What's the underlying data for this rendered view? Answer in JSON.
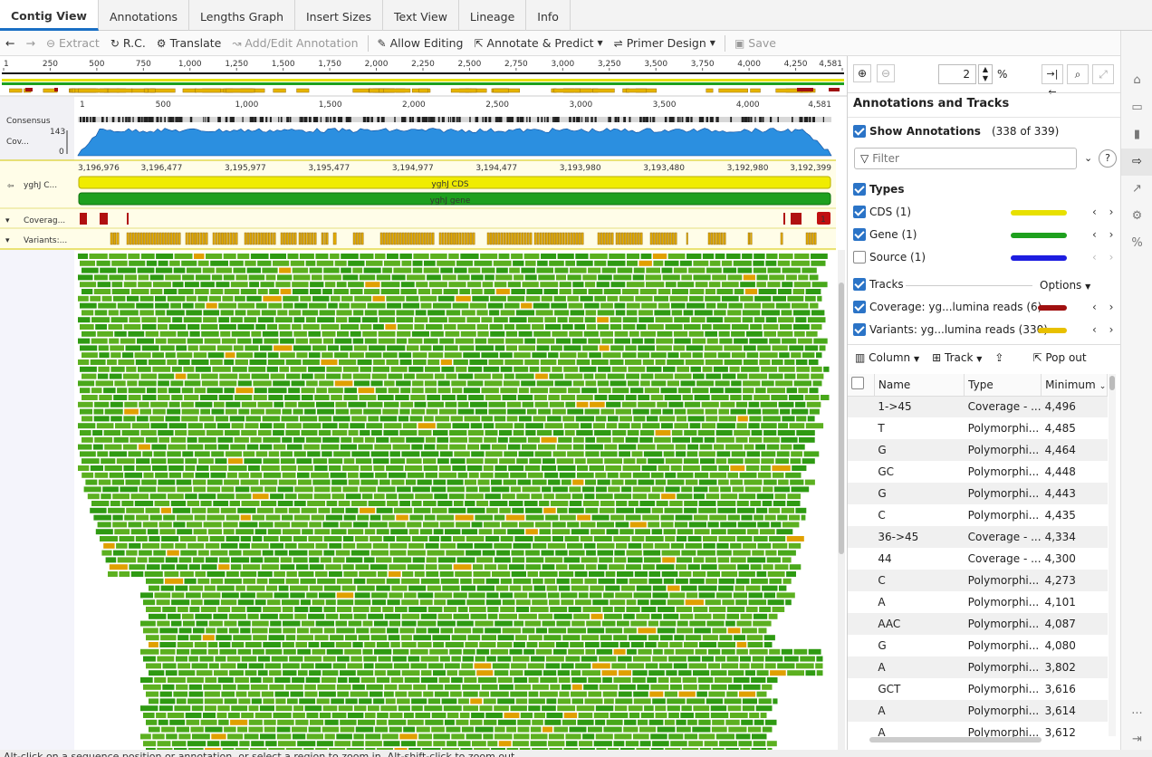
{
  "tabs": [
    "Contig View",
    "Annotations",
    "Lengths Graph",
    "Insert Sizes",
    "Text View",
    "Lineage",
    "Info"
  ],
  "toolbar": {
    "extract": "Extract",
    "rc": "R.C.",
    "translate": "Translate",
    "add_edit": "Add/Edit Annotation",
    "allow_editing": "Allow Editing",
    "annotate_predict": "Annotate & Predict",
    "primer_design": "Primer Design",
    "save": "Save"
  },
  "overview_ticks": [
    "1",
    "250",
    "500",
    "750",
    "1,000",
    "1,250",
    "1,500",
    "1,750",
    "2,000",
    "2,250",
    "2,500",
    "2,750",
    "3,000",
    "3,250",
    "3,500",
    "3,750",
    "4,000",
    "4,250",
    "4,581"
  ],
  "consensus_ticks": [
    "1",
    "500",
    "1,000",
    "1,500",
    "2,000",
    "2,500",
    "3,000",
    "3,500",
    "4,000",
    "4,581"
  ],
  "genome_ticks": [
    "3,196,976",
    "3,196,477",
    "3,195,977",
    "3,195,477",
    "3,194,977",
    "3,194,477",
    "3,193,980",
    "3,193,480",
    "3,192,980",
    "3,192,399"
  ],
  "tracks": {
    "consensus": "Consensus",
    "coverage": "Cov...",
    "cov_max": "143",
    "cov_min": "0",
    "annot_label": "yghJ C...",
    "cds_label": "yghJ CDS",
    "gene_label": "yghJ gene",
    "coverage_track": "Coverag...",
    "variants_track": "Variants:...",
    "badge": "1"
  },
  "zoom": {
    "value": "2",
    "unit": "%"
  },
  "panel": {
    "title": "Annotations and Tracks",
    "show_annotations": "Show Annotations",
    "show_count": "(338 of 339)",
    "filter_placeholder": "Filter",
    "types": "Types",
    "type_items": [
      {
        "label": "CDS (1)",
        "checked": true,
        "color": "#e8e000"
      },
      {
        "label": "Gene (1)",
        "checked": true,
        "color": "#1ea01e"
      },
      {
        "label": "Source (1)",
        "checked": false,
        "color": "#1d1de0"
      }
    ],
    "tracks_label": "Tracks",
    "options": "Options",
    "track_items": [
      {
        "label": "Coverage: yg...lumina reads (6)",
        "color": "#a01010"
      },
      {
        "label": "Variants: yg...lumina reads (330)",
        "color": "#e8c000"
      }
    ],
    "column": "Column",
    "track": "Track",
    "pop_out": "Pop out",
    "headers": [
      "Name",
      "Type",
      "Minimum"
    ],
    "rows": [
      [
        "1->45",
        "Coverage - ...",
        "4,496"
      ],
      [
        "T",
        "Polymorphi...",
        "4,485"
      ],
      [
        "G",
        "Polymorphi...",
        "4,464"
      ],
      [
        "GC",
        "Polymorphi...",
        "4,448"
      ],
      [
        "G",
        "Polymorphi...",
        "4,443"
      ],
      [
        "C",
        "Polymorphi...",
        "4,435"
      ],
      [
        "36->45",
        "Coverage - ...",
        "4,334"
      ],
      [
        "44",
        "Coverage - ...",
        "4,300"
      ],
      [
        "C",
        "Polymorphi...",
        "4,273"
      ],
      [
        "A",
        "Polymorphi...",
        "4,101"
      ],
      [
        "AAC",
        "Polymorphi...",
        "4,087"
      ],
      [
        "G",
        "Polymorphi...",
        "4,080"
      ],
      [
        "A",
        "Polymorphi...",
        "3,802"
      ],
      [
        "GCT",
        "Polymorphi...",
        "3,616"
      ],
      [
        "A",
        "Polymorphi...",
        "3,614"
      ],
      [
        "A",
        "Polymorphi...",
        "3,612"
      ]
    ]
  },
  "status": "Alt-click on a sequence position or annotation, or select a region to zoom in. Alt-shift-click to zoom out.",
  "colors": {
    "accent": "#2b74c7",
    "read": "#3aa019",
    "variant": "#e0a000",
    "coverage_fill": "#2b8fe0"
  }
}
